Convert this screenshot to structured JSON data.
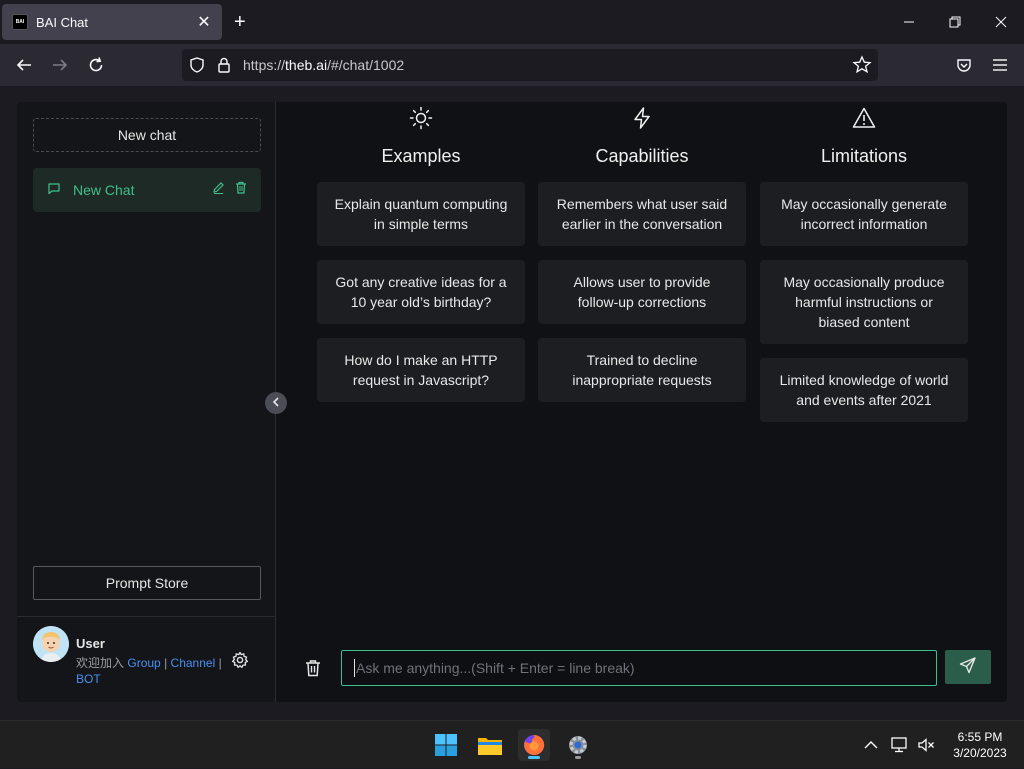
{
  "browser": {
    "tab_title": "BAI Chat",
    "favicon_text": "BAI",
    "url_prefix": "https://",
    "url_domain": "theb.ai",
    "url_path": "/#/chat/1002"
  },
  "sidebar": {
    "new_chat_label": "New chat",
    "chats": [
      {
        "label": "New Chat"
      }
    ],
    "prompt_store_label": "Prompt Store",
    "user": {
      "name": "User",
      "join_text": "欢迎加入",
      "group_link": "Group",
      "separator": "|",
      "channel_link": "Channel",
      "bot_link": "BOT"
    }
  },
  "main": {
    "columns": [
      {
        "icon": "sun-icon",
        "title": "Examples",
        "cards": [
          "Explain quantum computing in simple terms",
          "Got any creative ideas for a 10 year old’s birthday?",
          "How do I make an HTTP request in Javascript?"
        ]
      },
      {
        "icon": "lightning-icon",
        "title": "Capabilities",
        "cards": [
          "Remembers what user said earlier in the conversation",
          "Allows user to provide follow-up corrections",
          "Trained to decline inappropriate requests"
        ]
      },
      {
        "icon": "warning-icon",
        "title": "Limitations",
        "cards": [
          "May occasionally generate incorrect information",
          "May occasionally produce harmful instructions or biased content",
          "Limited knowledge of world and events after 2021"
        ]
      }
    ],
    "input_placeholder": "Ask me anything...(Shift + Enter = line break)"
  },
  "taskbar": {
    "time": "6:55 PM",
    "date": "3/20/2023"
  },
  "colors": {
    "accent": "#3fbf8c",
    "link": "#4a8ff0",
    "send_button": "#2a5d4a"
  }
}
